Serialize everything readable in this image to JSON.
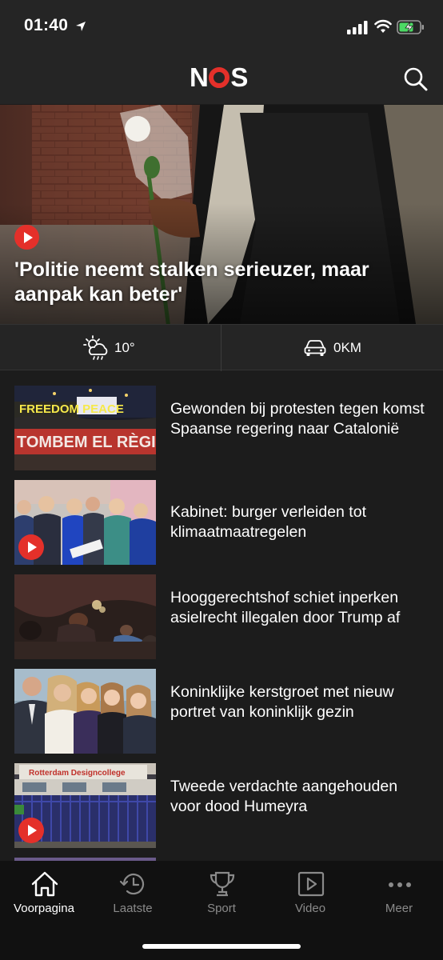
{
  "status_bar": {
    "time": "01:40"
  },
  "header": {
    "logo": {
      "n": "N",
      "s": "S"
    },
    "search_icon": "search-icon",
    "brand_color": "#e4302a"
  },
  "hero": {
    "title": "'Politie neemt stalken serieuzer, maar aanpak kan beter'",
    "has_video": true
  },
  "info_bar": {
    "weather_icon": "partly-cloudy-rain-icon",
    "temperature": "10°",
    "traffic_icon": "car-icon",
    "traffic": "0KM"
  },
  "articles": [
    {
      "title": "Gewonden bij protesten tegen komst Spaanse regering naar Catalonië",
      "has_video": false,
      "thumb_text_1": "FREEDOM  PEACE",
      "thumb_text_2": "TOMBEM EL RÈGIM"
    },
    {
      "title": "Kabinet: burger verleiden tot klimaatmaatregelen",
      "has_video": true
    },
    {
      "title": "Hooggerechtshof schiet inperken asielrecht illegalen door Trump af",
      "has_video": false
    },
    {
      "title": "Koninklijke kerstgroet met nieuw portret van koninklijk gezin",
      "has_video": false
    },
    {
      "title": "Tweede verdachte aangehouden voor dood Humeyra",
      "has_video": true,
      "thumb_text_1": "Rotterdam  Designcollege"
    }
  ],
  "tab_bar": {
    "tabs": [
      {
        "label": "Voorpagina",
        "icon": "home-icon",
        "active": true
      },
      {
        "label": "Laatste",
        "icon": "clock-icon",
        "active": false
      },
      {
        "label": "Sport",
        "icon": "trophy-icon",
        "active": false
      },
      {
        "label": "Video",
        "icon": "video-icon",
        "active": false
      },
      {
        "label": "Meer",
        "icon": "more-icon",
        "active": false
      }
    ]
  }
}
